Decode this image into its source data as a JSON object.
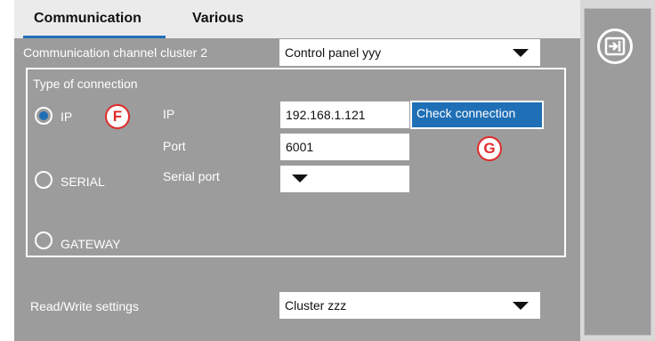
{
  "tabs": [
    {
      "label": "Communication"
    },
    {
      "label": "Various"
    }
  ],
  "cluster": {
    "label": "Communication channel cluster 2",
    "value": "Control panel yyy"
  },
  "connection": {
    "title": "Type of connection",
    "options": [
      {
        "label": "IP",
        "checked": true
      },
      {
        "label": "SERIAL",
        "checked": false
      },
      {
        "label": "GATEWAY",
        "checked": false
      }
    ],
    "ip_label": "IP",
    "ip_value": "192.168.1.121",
    "port_label": "Port",
    "port_value": "6001",
    "serial_port_label": "Serial port",
    "serial_port_value": "",
    "check_button": "Check connection"
  },
  "settings": {
    "label": "Read/Write settings",
    "value": "Cluster zzz"
  },
  "markers": {
    "f": "F",
    "g": "G"
  },
  "icons": {
    "exit": "exit-icon",
    "dropdown": "chevron-down-icon"
  },
  "colors": {
    "accent": "#1f6fb6",
    "panel": "#9c9c9c",
    "marker": "#e12a2a"
  }
}
